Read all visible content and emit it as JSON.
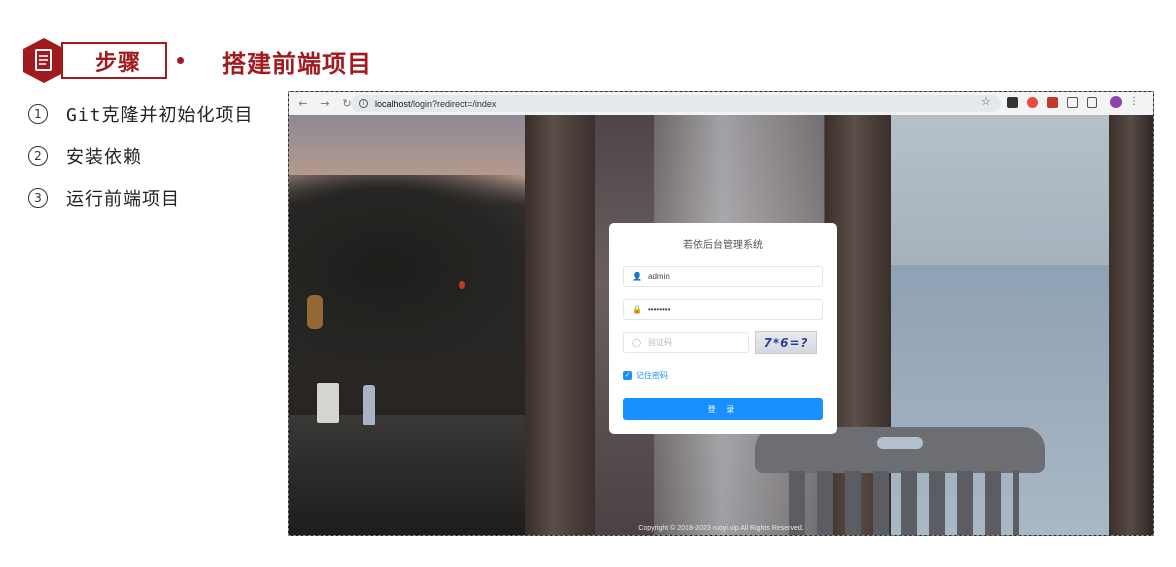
{
  "slide": {
    "step_label": "步骤",
    "title": "搭建前端项目",
    "steps": [
      {
        "num": "1",
        "text": "Git克隆并初始化项目"
      },
      {
        "num": "2",
        "text": "安装依赖"
      },
      {
        "num": "3",
        "text": "运行前端项目"
      }
    ],
    "accent_color": "#a11a1d"
  },
  "browser": {
    "url_host": "localhost",
    "url_path": "/login?redirect=/index",
    "icons": [
      "back-arrow-icon",
      "forward-arrow-icon",
      "reload-icon",
      "info-icon",
      "star-icon",
      "extension-icon",
      "profile-avatar",
      "menu-dots-icon"
    ]
  },
  "login": {
    "title": "若依后台管理系统",
    "username": "admin",
    "password_mask": "••••••••",
    "captcha_placeholder": "验证码",
    "captcha_text": "7*6=?",
    "remember_label": "记住密码",
    "remember_checked": true,
    "login_button": "登 录",
    "primary_color": "#1890ff"
  },
  "footer": {
    "copyright": "Copyright © 2018-2023 ruoyi.vip All Rights Reserved."
  }
}
